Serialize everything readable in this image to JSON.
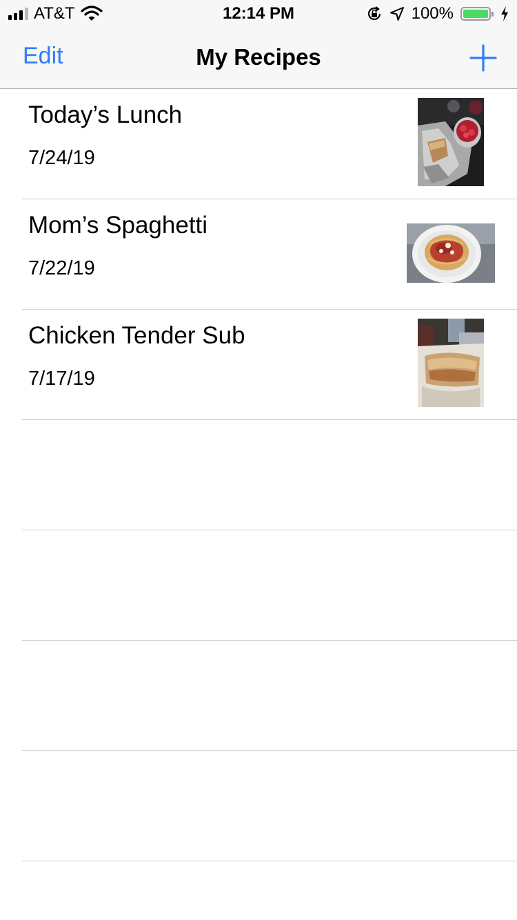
{
  "status_bar": {
    "carrier": "AT&T",
    "time": "12:14 PM",
    "battery": "100%",
    "battery_level": 1.0,
    "signal_bars": 3,
    "icons": [
      "signal-icon",
      "wifi-icon",
      "orientation-lock-icon",
      "location-icon",
      "battery-icon",
      "charging-icon"
    ]
  },
  "nav": {
    "edit_label": "Edit",
    "title": "My Recipes",
    "add_icon": "plus-icon",
    "accent": "#2f7cf6"
  },
  "recipes": [
    {
      "title": "Today’s Lunch",
      "date": "7/24/19"
    },
    {
      "title": "Mom’s Spaghetti",
      "date": "7/22/19"
    },
    {
      "title": "Chicken Tender Sub",
      "date": "7/17/19"
    }
  ],
  "empty_rows": 4
}
